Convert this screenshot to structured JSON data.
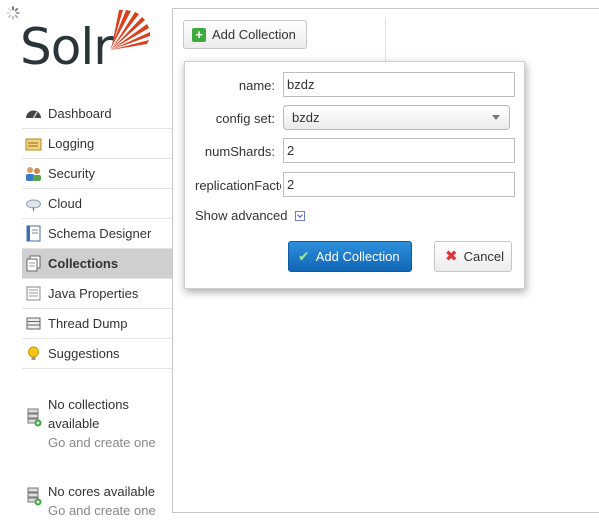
{
  "brand": {
    "logo_text": "Solr",
    "accent": "#d9411e"
  },
  "sidebar": {
    "items": [
      {
        "label": "Dashboard",
        "icon": "dashboard-icon"
      },
      {
        "label": "Logging",
        "icon": "logging-icon"
      },
      {
        "label": "Security",
        "icon": "security-icon"
      },
      {
        "label": "Cloud",
        "icon": "cloud-icon"
      },
      {
        "label": "Schema Designer",
        "icon": "schema-designer-icon"
      },
      {
        "label": "Collections",
        "icon": "collections-icon",
        "active": true
      },
      {
        "label": "Java Properties",
        "icon": "java-properties-icon"
      },
      {
        "label": "Thread Dump",
        "icon": "thread-dump-icon"
      },
      {
        "label": "Suggestions",
        "icon": "suggestions-icon"
      }
    ],
    "collections_notice": {
      "line1": "No collections",
      "line2": "available",
      "link": "Go and create one"
    },
    "cores_notice": {
      "line1": "No cores available",
      "link": "Go and create one"
    }
  },
  "toolbar": {
    "add_collection_label": "Add Collection"
  },
  "popup": {
    "name": {
      "label": "name:",
      "value": "bzdz"
    },
    "config_set": {
      "label": "config set:",
      "value": "bzdz"
    },
    "num_shards": {
      "label": "numShards:",
      "value": "2"
    },
    "replication_factor": {
      "label": "replicationFactor:",
      "value": "2"
    },
    "show_advanced": "Show advanced",
    "submit_label": "Add Collection",
    "cancel_label": "Cancel"
  }
}
